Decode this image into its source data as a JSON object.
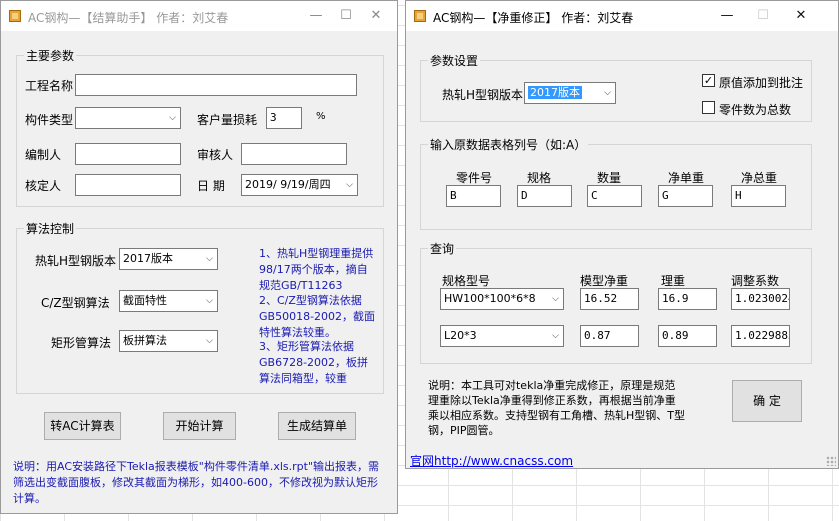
{
  "w1": {
    "title": "AC钢构—【结算助手】 作者：刘艾春",
    "min": "—",
    "max": "☐",
    "close": "✕",
    "main_group": "主要参数",
    "project_label": "工程名称",
    "project_value": "",
    "component_label": "构件类型",
    "component_value": "",
    "loss_label": "客户量损耗",
    "loss_value": "3",
    "loss_unit": "%",
    "editor_label": "编制人",
    "editor_value": "",
    "reviewer_label": "审核人",
    "reviewer_value": "",
    "checker_label": "核定人",
    "checker_value": "",
    "date_label": "日 期",
    "date_value": "2019/ 9/19/周四",
    "algo_group": "算法控制",
    "hsteel_label": "热轧H型钢版本",
    "hsteel_value": "2017版本",
    "cz_label": "C/Z型钢算法",
    "cz_value": "截面特性",
    "rect_label": "矩形管算法",
    "rect_value": "板拼算法",
    "note1": "1、热轧H型钢理重提供98/17两个版本，摘自规范GB/T11263",
    "note2": "2、C/Z型钢算法依据GB50018-2002，截面特性算法较重。",
    "note3": "3、矩形管算法依据GB6728-2002，板拼算法同箱型，较重",
    "btn_convert": "转AC计算表",
    "btn_calc": "开始计算",
    "btn_generate": "生成结算单",
    "bottom_note": "说明：用AC安装路径下Tekla报表模板\"构件零件清单.xls.rpt\"输出报表，需筛选出变截面腹板，修改其截面为梯形，如400-600，不修改视为默认矩形计算。"
  },
  "w2": {
    "title": "AC钢构—【净重修正】 作者：刘艾春",
    "min": "—",
    "max": "☐",
    "close": "✕",
    "param_group": "参数设置",
    "hsteel_label": "热轧H型钢版本",
    "hsteel_value": "2017版本",
    "chk_add_label": "原值添加到批注",
    "chk_add_checked": true,
    "chk_total_label": "零件数为总数",
    "chk_total_checked": false,
    "col_group": "输入原数据表格列号（如:A）",
    "cols": [
      {
        "label": "零件号",
        "value": "B"
      },
      {
        "label": "规格",
        "value": "D"
      },
      {
        "label": "数量",
        "value": "C"
      },
      {
        "label": "净单重",
        "value": "G"
      },
      {
        "label": "净总重",
        "value": "H"
      }
    ],
    "query_group": "查询",
    "q_headers": [
      "规格型号",
      "模型净重",
      "理重",
      "调整系数"
    ],
    "q_rows": [
      {
        "spec": "HW100*100*6*8",
        "model": "16.52",
        "theo": "16.9",
        "coef": "1.0230024"
      },
      {
        "spec": "L20*3",
        "model": "0.87",
        "theo": "0.89",
        "coef": "1.0229885"
      }
    ],
    "note": "说明：本工具可对tekla净重完成修正，原理是规范理重除以Tekla净重得到修正系数，再根据当前净重乘以相应系数。支持型钢有工角槽、热轧H型钢、T型钢，PIP圆管。",
    "ok": "确 定",
    "link_prefix": "官网",
    "link_url": "http://www.cnacss.com"
  }
}
